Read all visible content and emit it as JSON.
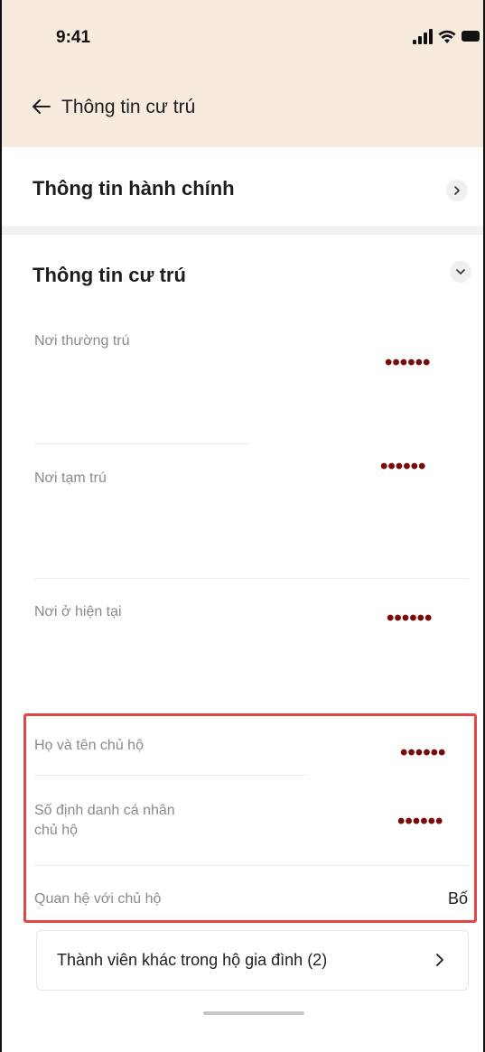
{
  "status_bar": {
    "time": "9:41"
  },
  "nav": {
    "title": "Thông tin cư trú"
  },
  "sections": {
    "admin": {
      "title": "Thông tin hành chính"
    },
    "residence": {
      "title": "Thông tin cư trú"
    }
  },
  "fields": {
    "permanent": {
      "label": "Nơi thường trú",
      "value": "••••••"
    },
    "temporary": {
      "label": "Nơi tạm trú",
      "value": "••••••"
    },
    "current": {
      "label": "Nơi ở hiện tại",
      "value": "••••••"
    },
    "head_name": {
      "label": "Họ và tên chủ hộ",
      "value": "••••••"
    },
    "head_id": {
      "label_line1": "Số định danh cá nhân",
      "label_line2": "chủ hộ",
      "value": "••••••"
    },
    "relation": {
      "label": "Quan hệ với chủ hộ",
      "value": "Bố"
    }
  },
  "members_button": {
    "label": "Thành viên khác trong hộ gia đình (2)"
  },
  "colors": {
    "header_bg": "#f7ebdd",
    "masked_value": "#7a0a0a",
    "highlight_border": "#e04848"
  }
}
